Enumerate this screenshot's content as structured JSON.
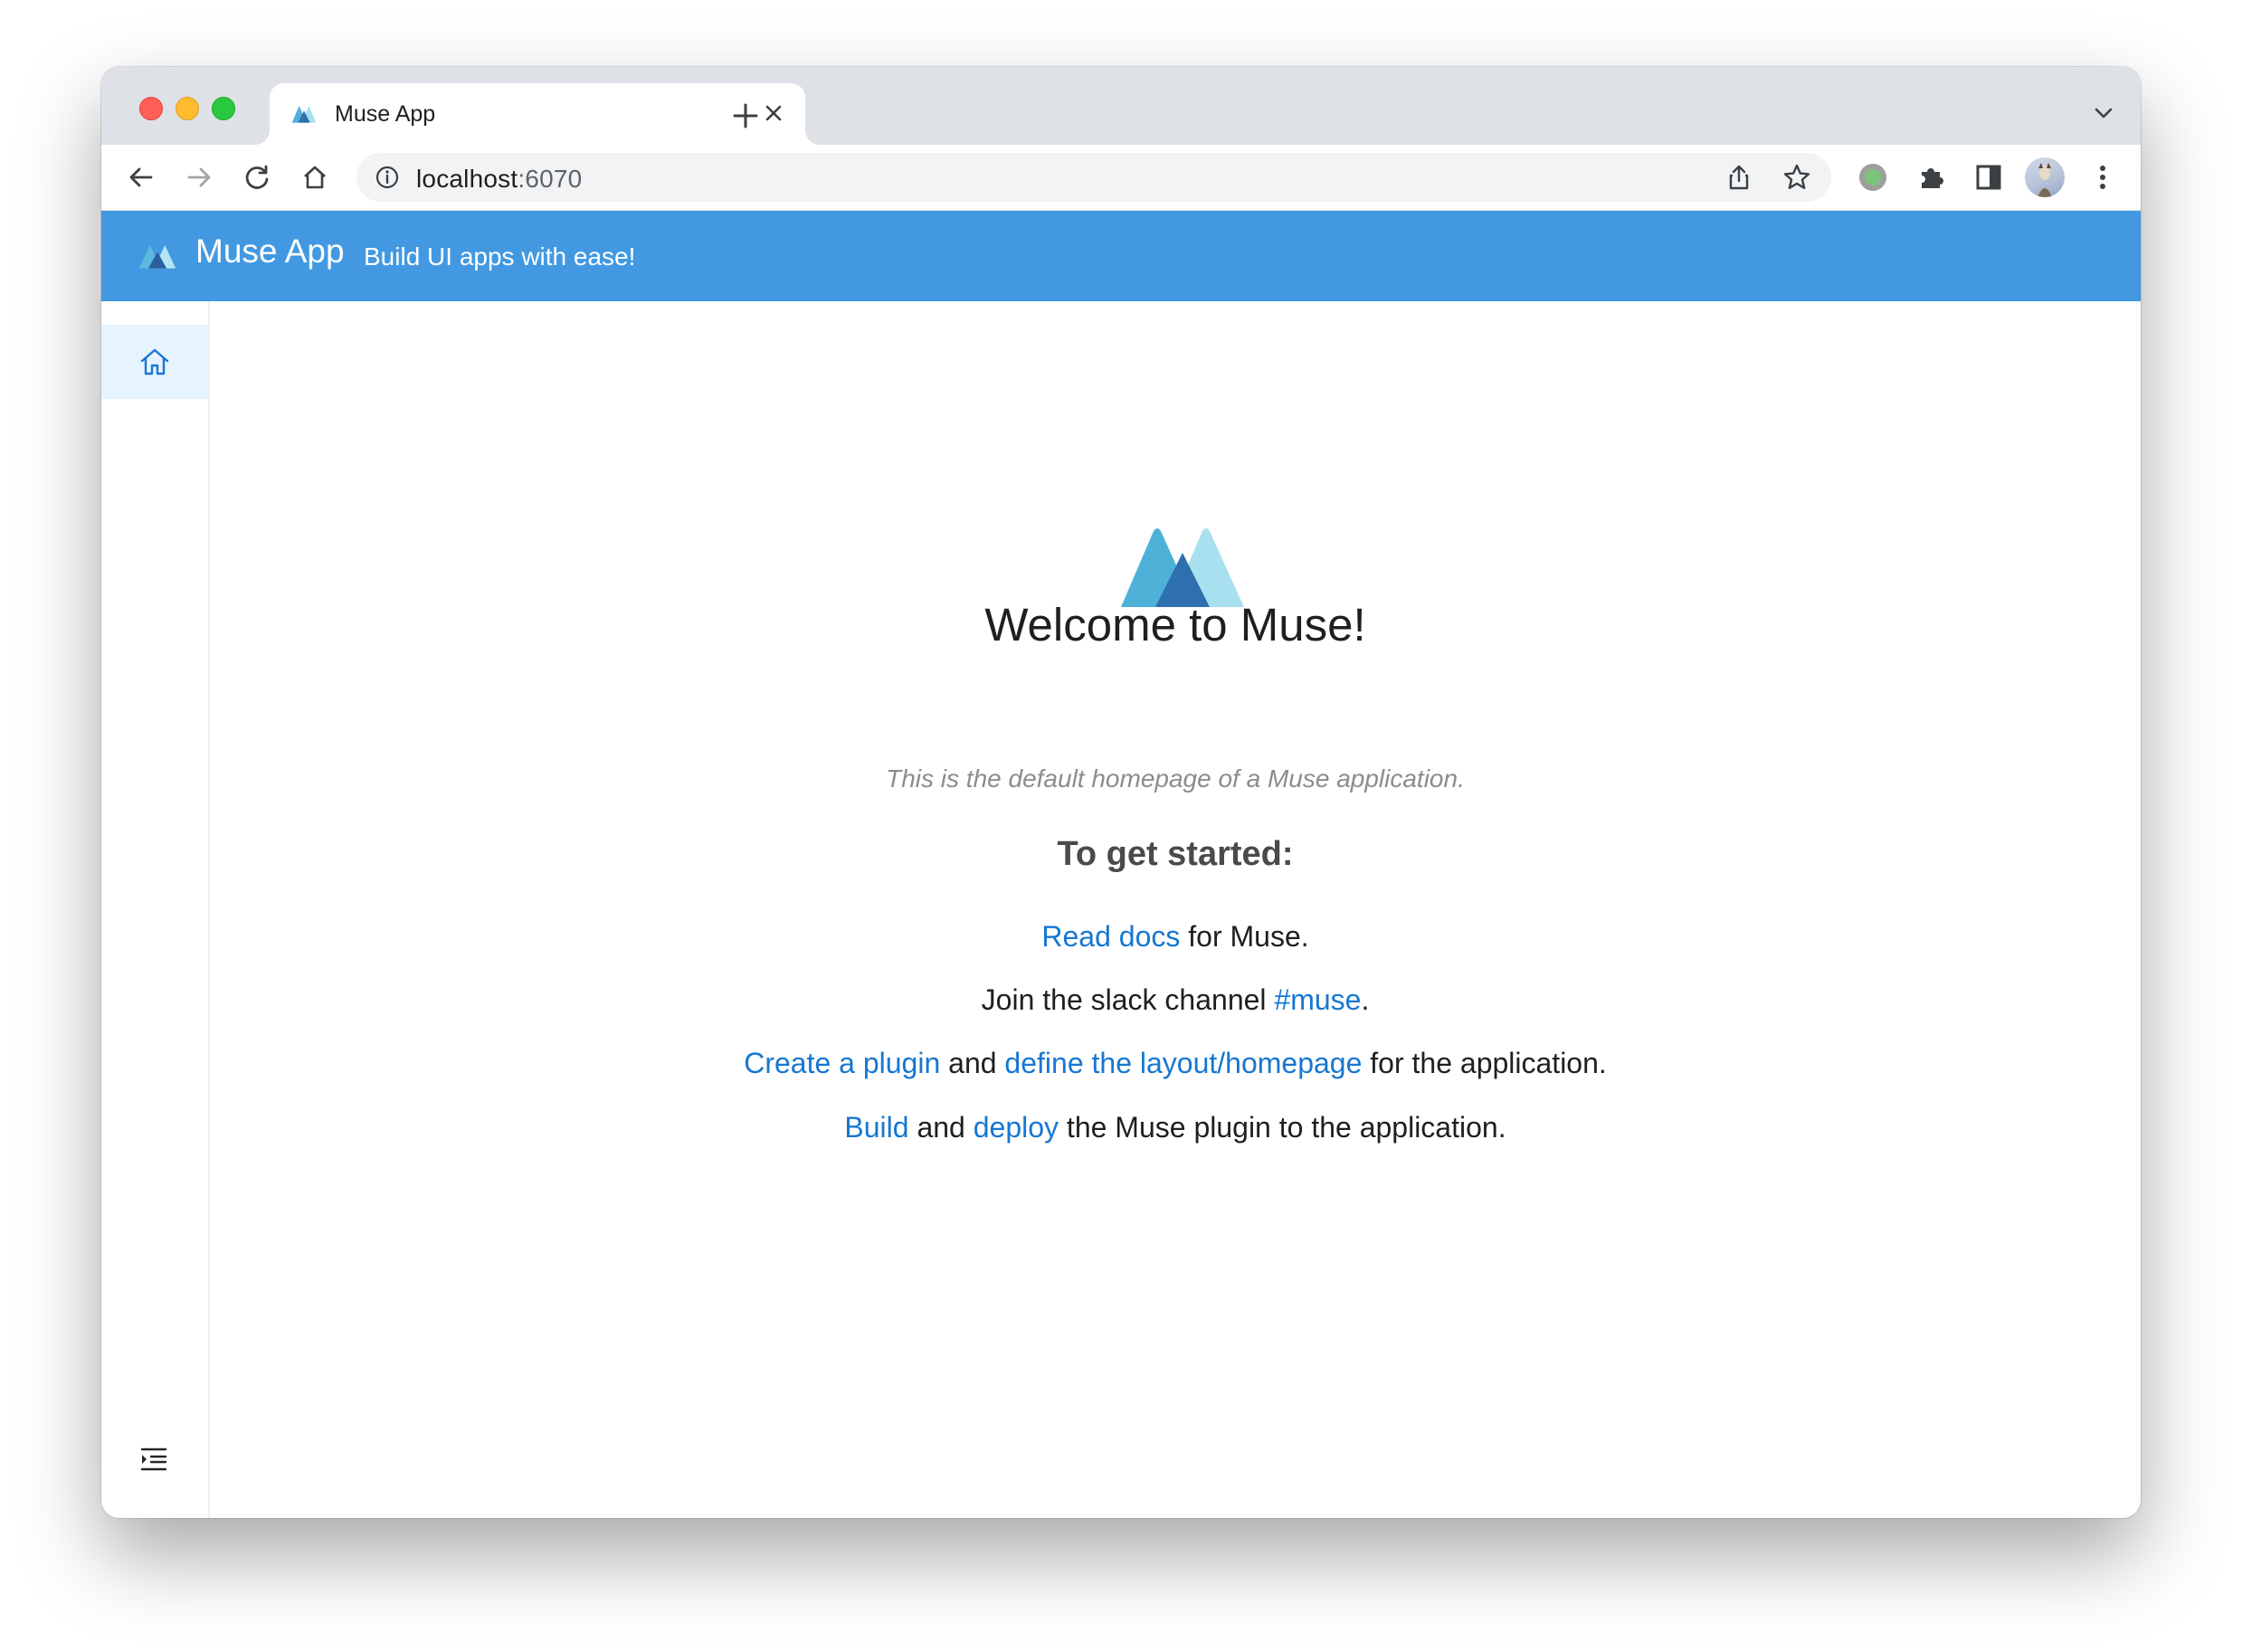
{
  "browser": {
    "tab": {
      "title": "Muse App"
    },
    "address": {
      "host": "localhost",
      "port": ":6070"
    }
  },
  "app": {
    "title": "Muse App",
    "subtitle": "Build UI apps with ease!",
    "accent_color": "#4299e1"
  },
  "sidebar": {
    "items": [
      {
        "icon": "home-icon",
        "active": true
      }
    ],
    "footer_icon": "menu-unfold-icon"
  },
  "main": {
    "heading": "Welcome to Muse!",
    "tagline": "This is the default homepage of a Muse application.",
    "started_heading": "To get started:",
    "lines": [
      {
        "link1": "Read docs",
        "text1": " for Muse."
      },
      {
        "text0": "Join the slack channel ",
        "link1": "#muse",
        "text1": "."
      },
      {
        "link1": "Create a plugin",
        "text1": " and ",
        "link2": "define the layout/homepage",
        "text2": " for the application."
      },
      {
        "link1": "Build",
        "text1": " and ",
        "link2": "deploy",
        "text2": " the Muse plugin to the application."
      }
    ],
    "link_color": "#1677d2"
  }
}
